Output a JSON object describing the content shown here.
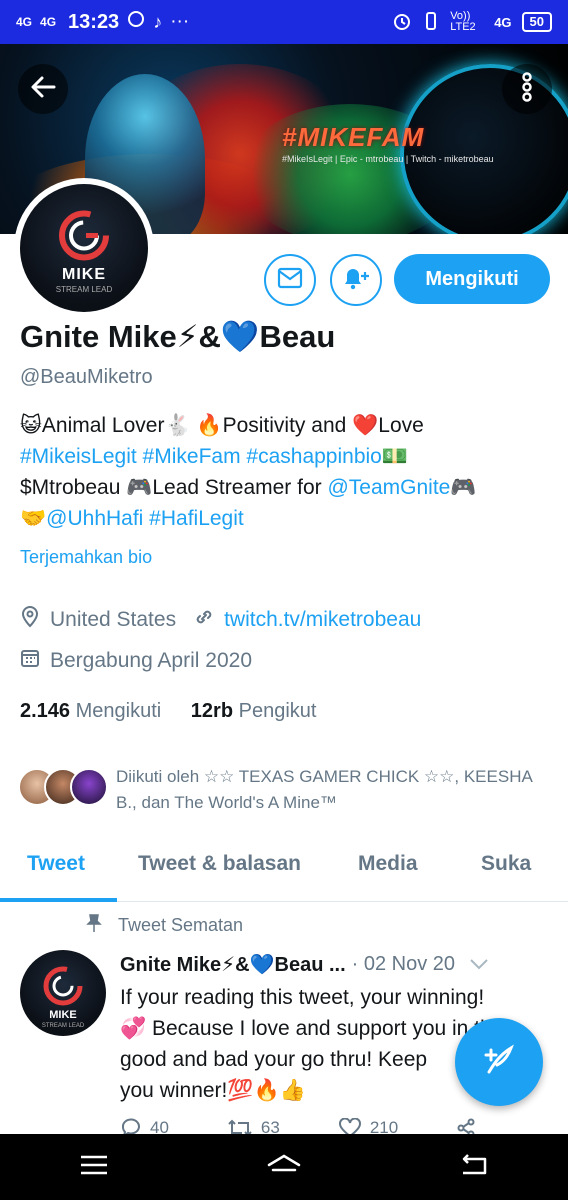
{
  "status_bar": {
    "signal1": "4G",
    "signal2": "4G",
    "time": "13:23",
    "extra": "···",
    "network_right": "Vo)) LTE2",
    "network_4g": "4G",
    "battery": "50"
  },
  "banner": {
    "title": "#MIKEFAM",
    "subline": "#MikeIsLegit | Epic - mtrobeau | Twitch - miketrobeau"
  },
  "avatar": {
    "label": "MIKE",
    "sublabel": "STREAM LEAD"
  },
  "actions": {
    "follow_label": "Mengikuti"
  },
  "profile": {
    "name": "Gnite Mike⚡&💙Beau",
    "handle": "@BeauMiketro",
    "bio_line1": "😺Animal Lover🐇 🔥Positivity and ❤️Love",
    "bio_line2_links": "#MikeisLegit #MikeFam #cashappinbio",
    "bio_line2_emoji": "💵",
    "bio_line3_text": "$Mtrobeau 🎮Lead Streamer for ",
    "bio_line3_link": "@TeamGnite",
    "bio_line3_end": "🎮",
    "bio_line4_emoji": "🤝",
    "bio_line4_links": "@UhhHafi #HafiLegit",
    "translate": "Terjemahkan bio",
    "location": "United States",
    "website": "twitch.tv/miketrobeau",
    "joined": "Bergabung April 2020",
    "following_count": "2.146",
    "following_label": "Mengikuti",
    "followers_count": "12rb",
    "followers_label": "Pengikut",
    "followed_by": "Diikuti oleh ☆☆ TEXAS GAMER CHICK ☆☆, KEESHA B., dan The World's A Mine™"
  },
  "tabs": [
    {
      "label": "Tweet"
    },
    {
      "label": "Tweet & balasan"
    },
    {
      "label": "Media"
    },
    {
      "label": "Suka"
    }
  ],
  "pinned_tweet": {
    "pinned_label": "Tweet Sematan",
    "author": "Gnite Mike⚡&💙Beau ...",
    "date": "· 02 Nov 20",
    "line1": "If your reading this tweet, your winning!",
    "line2": "💞 Because I love and support you in the",
    "line3": "good and bad your go thru! Keep",
    "line4": "you winner!💯🔥👍",
    "replies": "40",
    "retweets": "63",
    "likes": "210"
  },
  "colors": {
    "accent": "#1da1f2",
    "statusbar": "#1d2be0",
    "secondary_text": "#657786"
  }
}
